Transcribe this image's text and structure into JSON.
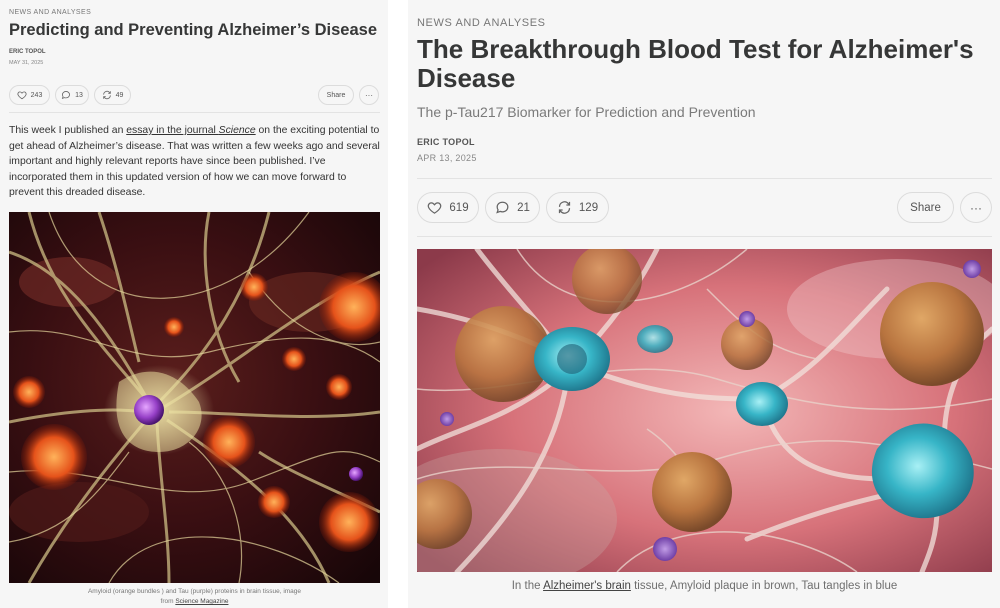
{
  "left": {
    "section": "NEWS AND ANALYSES",
    "title": "Predicting and Preventing Alzheimer’s Disease",
    "author": "ERIC TOPOL",
    "date": "MAY 31, 2025",
    "likes": "243",
    "comments": "13",
    "restacks": "49",
    "share_label": "Share",
    "more_label": "···",
    "intro_before_link": "This week I published an ",
    "intro_link": "essay in the journal ",
    "intro_link_italic": "Science",
    "intro_after_link": " on the exciting potential to get ahead of Alzheimer’s disease. That was written a few weeks ago and several important and highly relevant reports have since been published. I’ve incorporated them in this updated version of how we can move forward to prevent this dreaded disease.",
    "caption_line1": "Amyloid (orange bundles ) and Tau (purple) proteins in brain tissue, image",
    "caption_from": "from ",
    "caption_link": "Science Magazine"
  },
  "right": {
    "section": "NEWS AND ANALYSES",
    "title": "The Breakthrough Blood Test for Alzheimer's Disease",
    "subtitle": "The p-Tau217 Biomarker for Prediction and Prevention",
    "author": "ERIC TOPOL",
    "date": "APR 13, 2025",
    "likes": "619",
    "comments": "21",
    "restacks": "129",
    "share_label": "Share",
    "more_label": "···",
    "caption_before": "In the ",
    "caption_link": "Alzheimer's brain",
    "caption_after": " tissue, Amyloid plaque in brown, Tau tangles in blue"
  },
  "icons": {
    "like": "heart-icon",
    "comment": "comment-icon",
    "restack": "restack-icon",
    "more": "ellipsis-icon"
  }
}
